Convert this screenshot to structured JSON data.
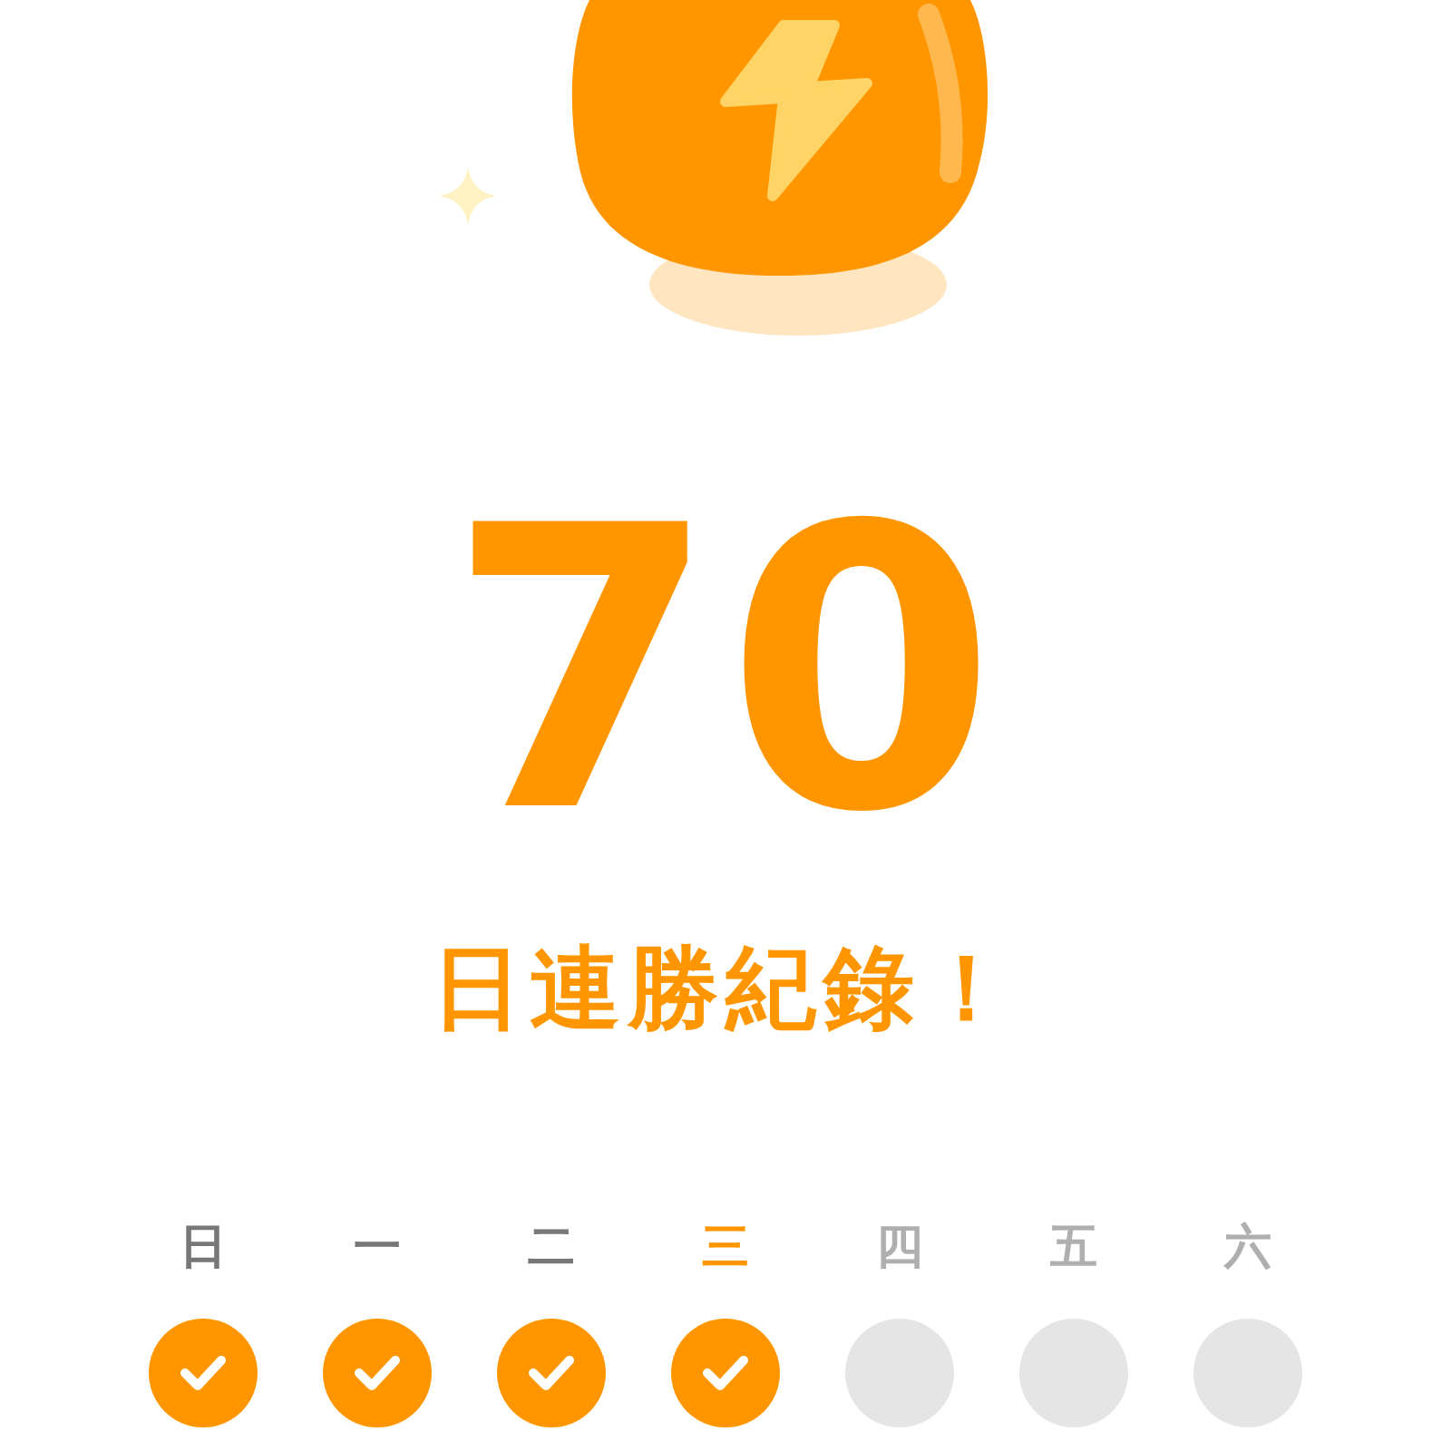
{
  "streak": {
    "count": "70",
    "caption": "日連勝紀錄！"
  },
  "days": [
    {
      "label": "日",
      "checked": true,
      "selected": false
    },
    {
      "label": "一",
      "checked": true,
      "selected": false
    },
    {
      "label": "二",
      "checked": true,
      "selected": false
    },
    {
      "label": "三",
      "checked": true,
      "selected": true
    },
    {
      "label": "四",
      "checked": false,
      "selected": false
    },
    {
      "label": "五",
      "checked": false,
      "selected": false
    },
    {
      "label": "六",
      "checked": false,
      "selected": false
    }
  ]
}
